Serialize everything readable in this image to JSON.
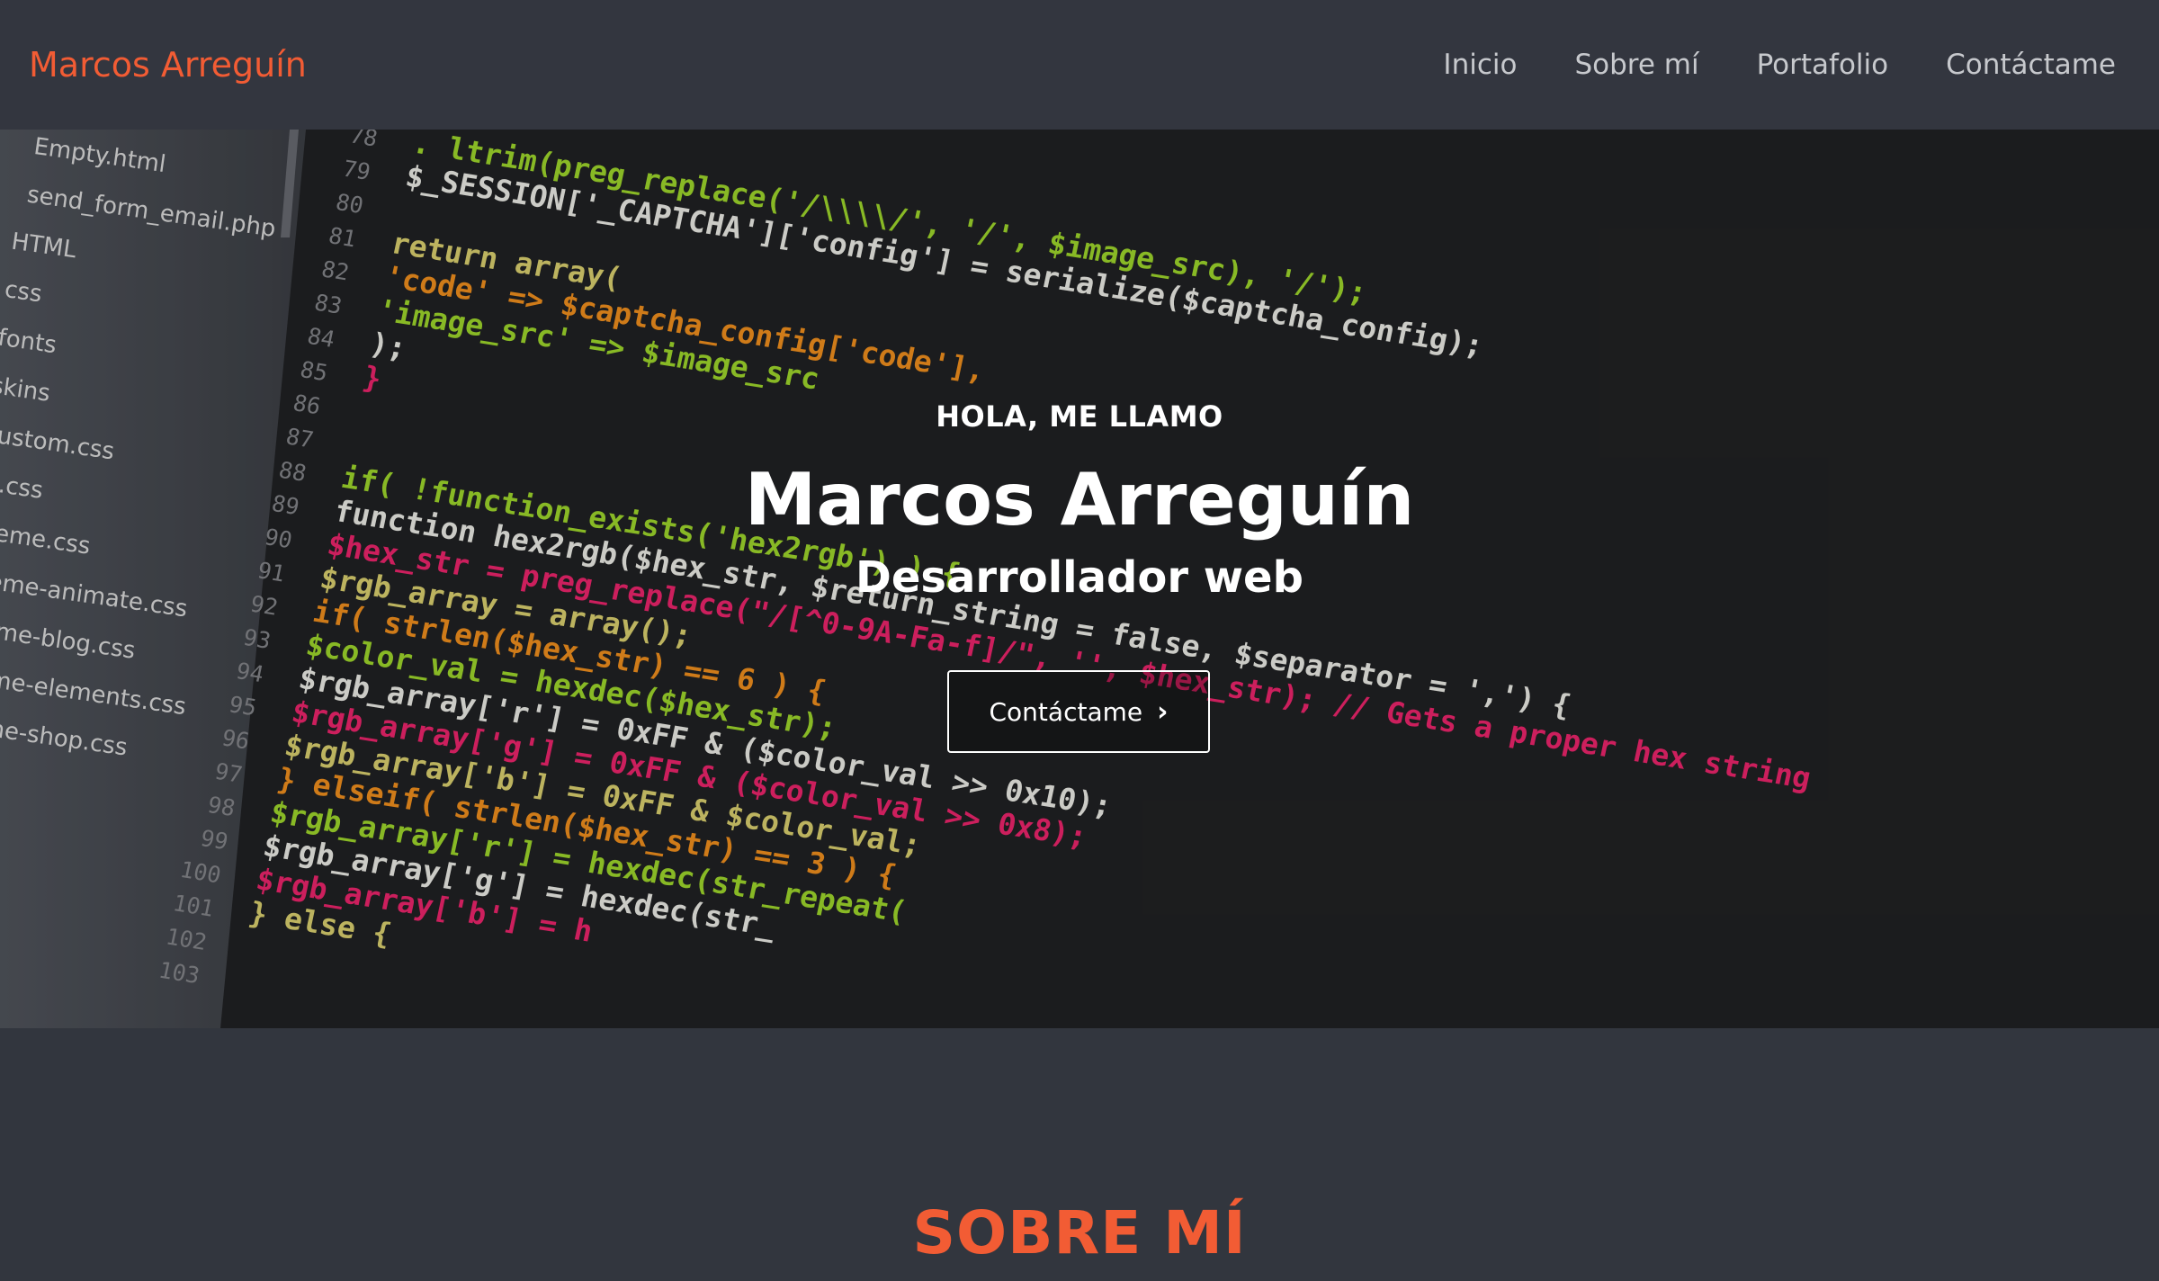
{
  "nav": {
    "brand": "Marcos Arreguín",
    "links": [
      "Inicio",
      "Sobre mí",
      "Portafolio",
      "Contáctame"
    ]
  },
  "hero": {
    "greeting": "HOLA, ME LLAMO",
    "name": "Marcos Arreguín",
    "role": "Desarrollador web",
    "cta_label": "Contáctame",
    "cta_icon": "chevron-right-icon",
    "background": {
      "files": [
        "Empty.html",
        "send_form_email.php",
        "HTML",
        "css",
        "fonts",
        "skins",
        "custom.css",
        "ie.css",
        "theme.css",
        "theme-animate.css",
        "theme-blog.css",
        "theme-elements.css",
        "theme-shop.css"
      ],
      "line_numbers": [
        "78",
        "79",
        "80",
        "81",
        "82",
        "83",
        "84",
        "85",
        "86",
        "87",
        "88",
        "89",
        "90",
        "91",
        "92",
        "93",
        "94",
        "95",
        "96",
        "97",
        "98",
        "99",
        "100",
        "101",
        "102",
        "103"
      ],
      "code_lines": [
        "    . ltrim(preg_replace('/\\\\\\\\/', '/', $image_src), '/');",
        "$_SESSION['_CAPTCHA']['config'] = serialize($captcha_config);",
        "",
        "return array(",
        "    'code' => $captcha_config['code'],",
        "    'image_src' => $image_src",
        ");",
        "}",
        "",
        "",
        "if( !function_exists('hex2rgb') ) {",
        "    function hex2rgb($hex_str, $return_string = false, $separator = ',') {",
        "        $hex_str = preg_replace(\"/[^0-9A-Fa-f]/\", '', $hex_str); // Gets a proper hex string",
        "        $rgb_array = array();",
        "        if( strlen($hex_str) == 6 ) {",
        "            $color_val = hexdec($hex_str);",
        "            $rgb_array['r'] = 0xFF & ($color_val >> 0x10);",
        "            $rgb_array['g'] = 0xFF & ($color_val >> 0x8);",
        "            $rgb_array['b'] = 0xFF & $color_val;",
        "        } elseif( strlen($hex_str) == 3 ) {",
        "            $rgb_array['r'] = hexdec(str_repeat(",
        "            $rgb_array['g'] = hexdec(str_",
        "            $rgb_array['b'] = h",
        "        } else {"
      ]
    }
  },
  "about": {
    "title": "SOBRE MÍ"
  },
  "colors": {
    "accent": "#f25c34",
    "nav_bg": "#33363f",
    "page_bg": "#32363e",
    "nav_link": "#c7c9cd"
  }
}
